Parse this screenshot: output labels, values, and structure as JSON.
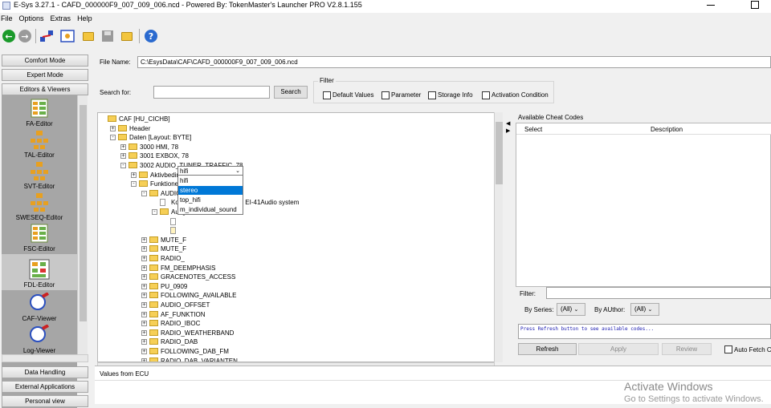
{
  "window": {
    "title": "E-Sys 3.27.1 - CAFD_000000F9_007_009_006.ncd  - Powered By: TokenMaster's Launcher PRO V2.8.1.155"
  },
  "menu": [
    "File",
    "Options",
    "Extras",
    "Help"
  ],
  "toolbar_icons": [
    "back-arrow-icon",
    "forward-arrow-icon",
    "connect-icon",
    "image-icon",
    "open-folder-icon",
    "save-icon",
    "folder-icon",
    "help-icon"
  ],
  "left": {
    "modes": [
      "Comfort Mode",
      "Expert Mode",
      "Editors & Viewers"
    ],
    "tools": [
      "FA-Editor",
      "TAL-Editor",
      "SVT-Editor",
      "SWESEQ-Editor",
      "FSC-Editor",
      "FDL-Editor",
      "CAF-Viewer",
      "Log-Viewer"
    ],
    "bottom": [
      "Data Handling",
      "External Applications",
      "Personal view"
    ]
  },
  "file": {
    "label": "File Name:",
    "value": "C:\\EsysData\\CAF\\CAFD_000000F9_007_009_006.ncd"
  },
  "search": {
    "label": "Search for:",
    "value": "",
    "button": "Search"
  },
  "filter": {
    "label": "Filter",
    "options": [
      "Default Values",
      "Parameter",
      "Storage Info",
      "Activation Condition"
    ]
  },
  "tree": [
    {
      "text": "CAF [HU_CICHB]",
      "level": 0,
      "exp": "",
      "type": "folder"
    },
    {
      "text": "Header",
      "level": 1,
      "exp": "+",
      "type": "folder"
    },
    {
      "text": "Daten [Layout: BYTE]",
      "level": 1,
      "exp": "-",
      "type": "folder"
    },
    {
      "text": "3000 HMI, 78",
      "level": 2,
      "exp": "+",
      "type": "folder"
    },
    {
      "text": "3001 EXBOX, 78",
      "level": 2,
      "exp": "+",
      "type": "folder"
    },
    {
      "text": "3002 AUDIO_TUNER_TRAFFIC, 78",
      "level": 2,
      "exp": "-",
      "type": "folder"
    },
    {
      "text": "Aktivbedingung",
      "level": 3,
      "exp": "+",
      "type": "folder"
    },
    {
      "text": "Funktionen",
      "level": 3,
      "exp": "-",
      "type": "folder"
    },
    {
      "text": "AUDIO_SYSTEM_CIC",
      "level": 4,
      "exp": "-",
      "type": "folder"
    },
    {
      "text": "Kommentar =Stefan Karl, EI-41Audio system",
      "level": 5,
      "exp": "",
      "type": "doc"
    },
    {
      "text": "Ausgelesen",
      "level": 5,
      "exp": "-",
      "type": "folder"
    },
    {
      "text": "",
      "level": 6,
      "exp": "",
      "type": "doc"
    },
    {
      "text": "",
      "level": 6,
      "exp": "",
      "type": "docedit"
    },
    {
      "text": "MUTE_F",
      "level": 4,
      "exp": "+",
      "type": "folder"
    },
    {
      "text": "MUTE_F",
      "level": 4,
      "exp": "+",
      "type": "folder"
    },
    {
      "text": "RADIO_",
      "level": 4,
      "exp": "+",
      "type": "folder"
    },
    {
      "text": "FM_DEEMPHASIS",
      "level": 4,
      "exp": "+",
      "type": "folder"
    },
    {
      "text": "GRACENOTES_ACCESS",
      "level": 4,
      "exp": "+",
      "type": "folder"
    },
    {
      "text": "PU_0909",
      "level": 4,
      "exp": "+",
      "type": "folder"
    },
    {
      "text": "FOLLOWING_AVAILABLE",
      "level": 4,
      "exp": "+",
      "type": "folder"
    },
    {
      "text": "AUDIO_OFFSET",
      "level": 4,
      "exp": "+",
      "type": "folder"
    },
    {
      "text": "AF_FUNKTION",
      "level": 4,
      "exp": "+",
      "type": "folder"
    },
    {
      "text": "RADIO_IBOC",
      "level": 4,
      "exp": "+",
      "type": "folder"
    },
    {
      "text": "RADIO_WEATHERBAND",
      "level": 4,
      "exp": "+",
      "type": "folder"
    },
    {
      "text": "RADIO_DAB",
      "level": 4,
      "exp": "+",
      "type": "folder"
    },
    {
      "text": "FOLLOWING_DAB_FM",
      "level": 4,
      "exp": "+",
      "type": "folder"
    },
    {
      "text": "RADIO_DAB_VARIANTEN",
      "level": 4,
      "exp": "+",
      "type": "folder"
    }
  ],
  "dropdown": {
    "selected": "hifi",
    "options": [
      "hifi",
      "stereo",
      "top_hifi",
      "m_individual_sound"
    ],
    "highlighted": 1
  },
  "cheat": {
    "title": "Available Cheat Codes",
    "col_select": "Select",
    "col_description": "Description",
    "filter_label": "Filter:",
    "series_label": "By Series:",
    "series_value": "(All)",
    "author_label": "By AUthor:",
    "author_value": "(All)",
    "console_text": "Press Refresh button to see available codes...",
    "refresh": "Refresh",
    "apply": "Apply",
    "review": "Review",
    "autofetch": "Auto Fetch C"
  },
  "values_panel": {
    "label": "Values from ECU"
  },
  "watermark": {
    "line1": "Activate Windows",
    "line2": "Go to Settings to activate Windows."
  },
  "colors": {
    "selection": "#0078d7",
    "panel_gray": "#a6a6a6",
    "folder": "#f6cf56"
  }
}
